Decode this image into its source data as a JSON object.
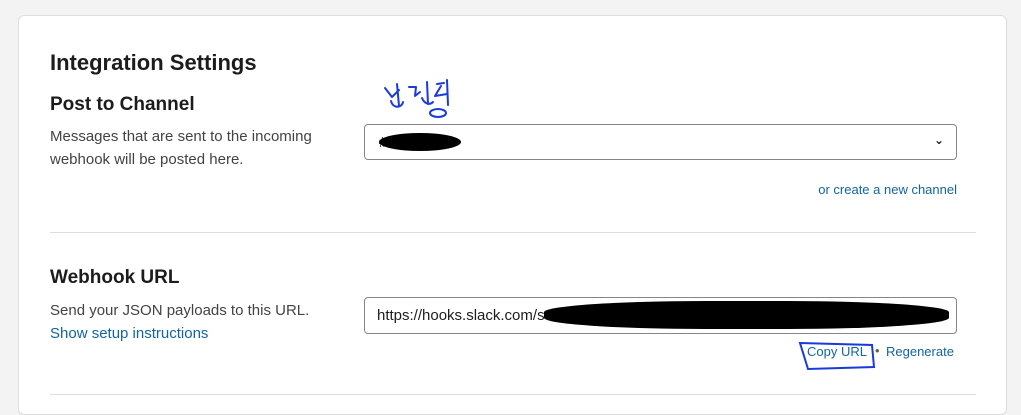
{
  "integration": {
    "title": "Integration Settings"
  },
  "post_to_channel": {
    "title": "Post to Channel",
    "description_line1": "Messages that are sent to the incoming",
    "description_line2": "webhook will be posted here.",
    "selected_channel": "#",
    "create_channel_link": "or create a new channel"
  },
  "webhook_url": {
    "title": "Webhook URL",
    "description": "Send your JSON payloads to this URL.",
    "setup_link": "Show setup instructions",
    "url_value": "https://hooks.slack.com/services/",
    "copy_label": "Copy URL",
    "separator": "•",
    "regenerate_label": "Regenerate"
  },
  "handwritten_note": "설정",
  "colors": {
    "link": "#1264a3",
    "annotation": "#1a3adb",
    "redaction": "#000000"
  },
  "icons": {
    "dropdown": "chevron-down-icon"
  }
}
